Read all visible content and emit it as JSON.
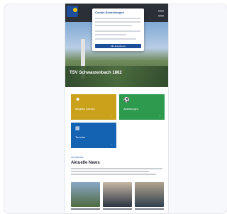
{
  "app": {
    "window_title": "TSV Schwarzenbach",
    "cookie_dialog": {
      "title": "Cookie-Einstellungen",
      "accept_button": "Alle akzeptieren"
    },
    "hero": {
      "title": "TSV Schwarzenbach 1862",
      "subtitle": ""
    },
    "tiles": [
      {
        "label": "Mitglied werden",
        "icon": "user-icon",
        "color": "#c9a11b"
      },
      {
        "label": "Abteilungen",
        "icon": "sports-icon",
        "color": "#2e9a4d"
      },
      {
        "label": "Termine",
        "icon": "calendar-icon",
        "color": "#1463b3"
      }
    ],
    "news": {
      "kicker": "AKTUELLES",
      "title": "Aktuelle News"
    }
  }
}
